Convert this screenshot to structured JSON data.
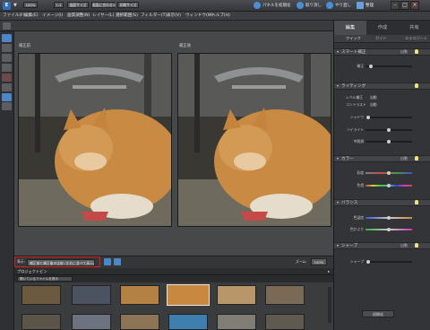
{
  "titlebar": {
    "app_caret": "▼",
    "panel_reset": "パネルを初期化",
    "undo": "取り消し",
    "redo": "やり直し",
    "organizer": "整理"
  },
  "menu": [
    "ファイル(F)",
    "編集(E)",
    "イメージ(I)",
    "画質調整(N)",
    "レイヤー(L)",
    "選択範囲(S)",
    "フィルター(T)",
    "表示(V)",
    "ウィンドウ(W)",
    "ヘルプ(H)"
  ],
  "options": {
    "zoom": "100%",
    "actual": "1:1",
    "fit": "画面サイズ",
    "fill": "画面に合わせる",
    "print": "印刷サイズ"
  },
  "canvas": {
    "before_label": "補正前",
    "after_label": "補正後"
  },
  "viewbar": {
    "view_label": "表示:",
    "view_value": "補正前と補正後の比較 (左右に並べて表示)",
    "zoom_label": "ズーム:",
    "zoom_value": "100%"
  },
  "bin": {
    "title": "プロジェクトビン",
    "source": "開いているファイルを表示"
  },
  "panel": {
    "tabs": [
      "編集",
      "作成",
      "共有"
    ],
    "subtabs": [
      "クイック",
      "ガイド",
      "エキスパート"
    ],
    "sections": [
      {
        "title": "スマート補正",
        "reset": "自動",
        "sliders": [
          "補正"
        ]
      },
      {
        "title": "ライティング",
        "reset": "自動",
        "autos": [
          [
            "レベル補正",
            "自動"
          ],
          [
            "コントラスト",
            "自動"
          ]
        ],
        "sliders": [
          "シャドウ",
          "ハイライト",
          "中間調"
        ]
      },
      {
        "title": "カラー",
        "reset": "自動",
        "sliders": [
          "彩度",
          "色相"
        ]
      },
      {
        "title": "バランス",
        "reset": "",
        "sliders": [
          "色温度",
          "色かぶり"
        ]
      },
      {
        "title": "シャープ",
        "reset": "自動",
        "sliders": [
          "シャープ"
        ]
      }
    ],
    "bottom_button": "初期化"
  },
  "accent_colors": {
    "highlight": "#d2232a",
    "brand": "#2f6fb7"
  }
}
